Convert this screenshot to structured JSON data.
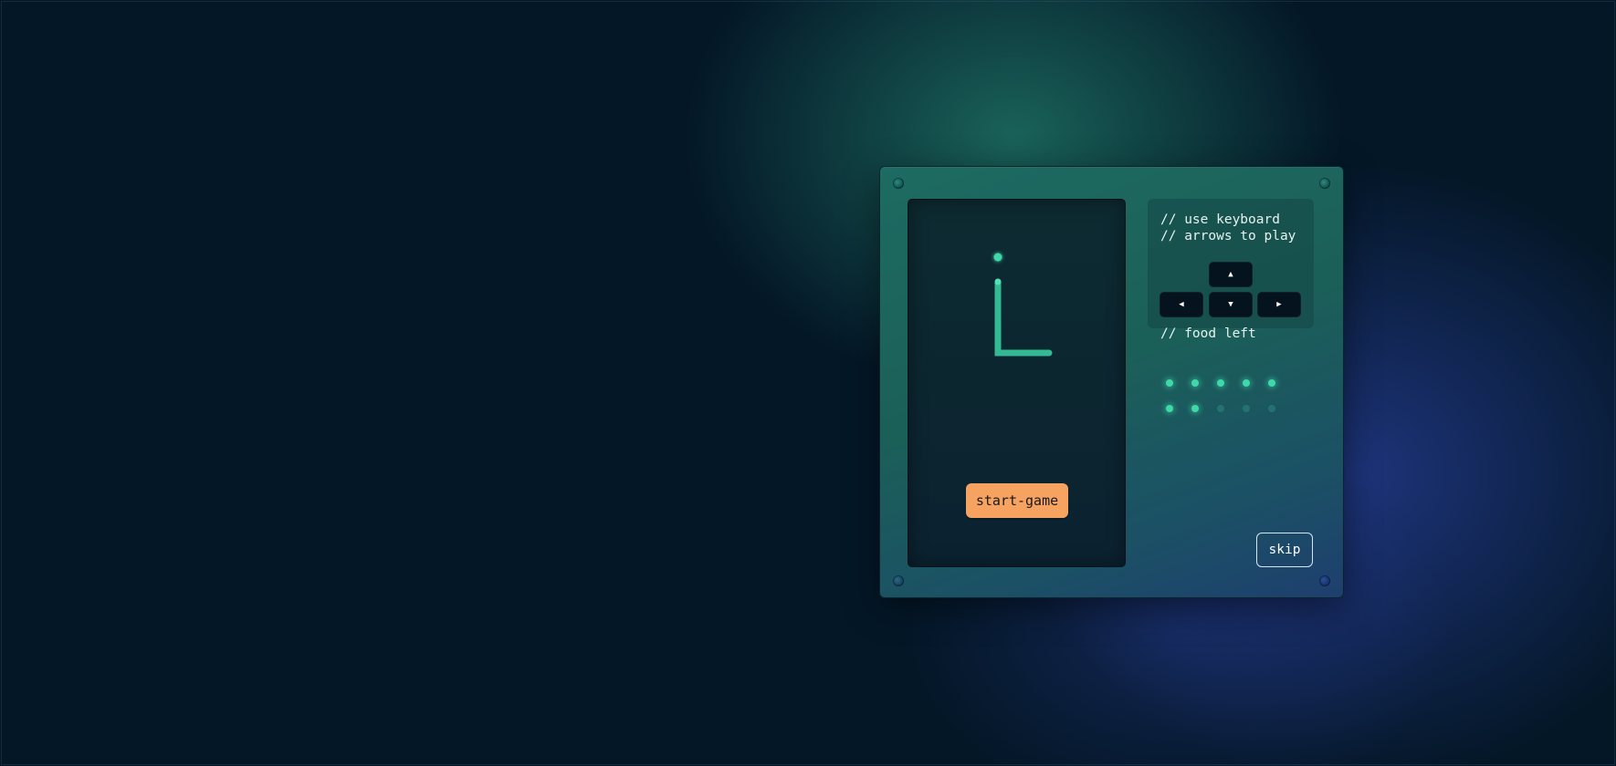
{
  "game": {
    "start_button_label": "start-game",
    "food_glow_color": "#3fd8a8",
    "snake_color": "#3fd8a8",
    "button_color": "#f6a362"
  },
  "controls": {
    "hint_line_1": "// use keyboard",
    "hint_line_2": "// arrows to play",
    "keys": [
      {
        "name": "arrow-up",
        "glyph": "▲"
      },
      {
        "name": "arrow-left",
        "glyph": "◀"
      },
      {
        "name": "arrow-down",
        "glyph": "▼"
      },
      {
        "name": "arrow-right",
        "glyph": "▶"
      }
    ]
  },
  "food": {
    "label": "// food left",
    "total": 10,
    "remaining": 7
  },
  "skip_label": "skip"
}
